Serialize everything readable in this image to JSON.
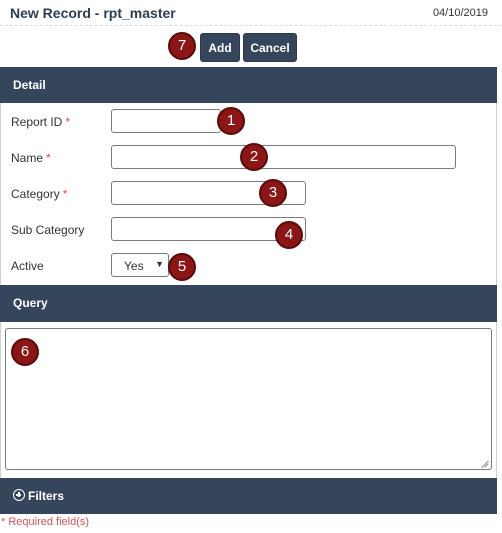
{
  "header": {
    "title": "New Record - rpt_master",
    "date": "04/10/2019"
  },
  "toolbar": {
    "add_label": "Add",
    "cancel_label": "Cancel"
  },
  "detail": {
    "section_title": "Detail",
    "required_marker": "*",
    "fields": {
      "report_id": {
        "label": "Report ID",
        "value": "",
        "required": true
      },
      "name": {
        "label": "Name",
        "value": "",
        "required": true
      },
      "category": {
        "label": "Category",
        "value": "",
        "required": true
      },
      "sub_category": {
        "label": "Sub Category",
        "value": "",
        "required": false
      },
      "active": {
        "label": "Active",
        "selected": "Yes"
      }
    }
  },
  "query": {
    "section_title": "Query",
    "value": ""
  },
  "filters": {
    "section_title": "Filters"
  },
  "footer": {
    "required_star": "*",
    "required_note": "Required field(s)"
  },
  "callouts": [
    "1",
    "2",
    "3",
    "4",
    "5",
    "6",
    "7"
  ],
  "colors": {
    "header_bg": "#35465c",
    "button_bg": "#35465c",
    "required": "#d9534f",
    "badge": "#8c1515"
  }
}
